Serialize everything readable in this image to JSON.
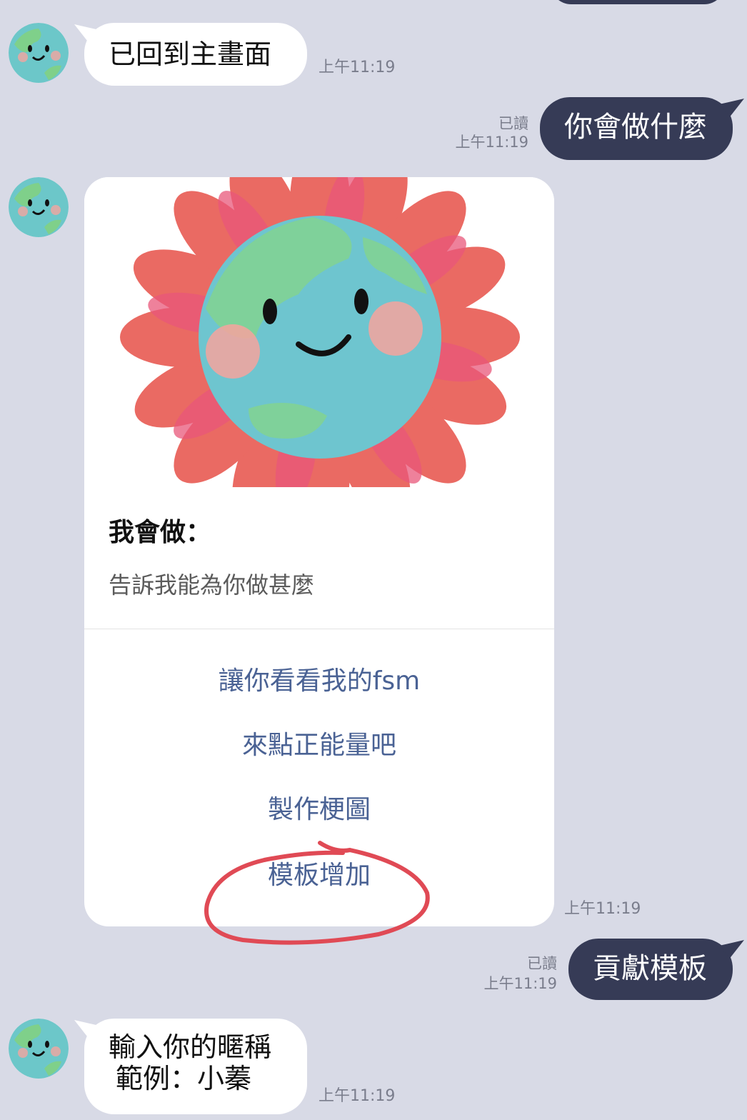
{
  "messages": {
    "m1": {
      "text": "已回到主畫面",
      "time": "上午11:19"
    },
    "m2": {
      "text": "你會做什麼",
      "read": "已讀",
      "time": "上午11:19"
    },
    "card": {
      "title": "我會做：",
      "description": "告訴我能為你做甚麼",
      "actions": [
        "讓你看看我的fsm",
        "來點正能量吧",
        "製作梗圖",
        "模板增加"
      ],
      "time": "上午11:19"
    },
    "m3": {
      "text": "貢獻模板",
      "read": "已讀",
      "time": "上午11:19"
    },
    "m4": {
      "line1": "輸入你的暱稱",
      "line2": "範例：小蓁",
      "time": "上午11:19"
    }
  },
  "colors": {
    "background": "#d8dae6",
    "outgoing_bubble": "#363b56",
    "incoming_bubble": "#ffffff",
    "action_text": "#4a6294",
    "annotation_circle": "#e04a55"
  },
  "icons": {
    "avatar": "smiling-earth-avatar",
    "hero": "smiling-earth-flower-image"
  }
}
